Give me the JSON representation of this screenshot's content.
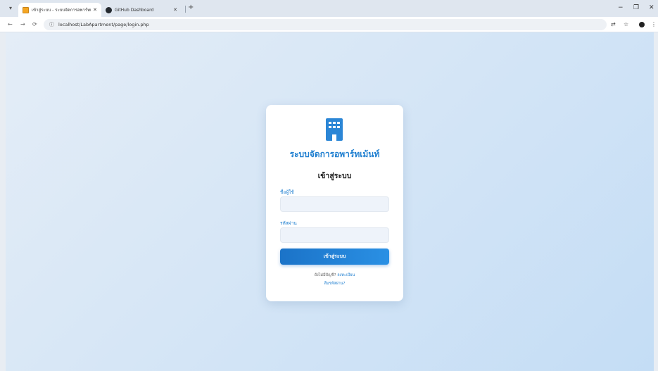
{
  "browser": {
    "tab_menu_glyph": "▾",
    "tabs": [
      {
        "title": "เข้าสู่ระบบ - ระบบจัดการอพาร์ทเม้นท์",
        "close": "✕",
        "favicon": "apartment-favicon"
      },
      {
        "title": "GitHub Dashboard",
        "close": "✕",
        "favicon": "github-favicon"
      }
    ],
    "new_tab": "+",
    "window_controls": {
      "minimize": "−",
      "restore": "❐",
      "close": "✕"
    },
    "nav": {
      "back": "←",
      "forward": "→",
      "reload": "⟳"
    },
    "address": {
      "info_glyph": "ⓘ",
      "url": "localhost/LabApartment/page/login.php"
    },
    "toolbar_icons": {
      "translate": "⇄",
      "bookmark": "☆",
      "menu": "⋮"
    }
  },
  "login": {
    "app_title": "ระบบจัดการอพาร์ทเม้นท์",
    "heading": "เข้าสู่ระบบ",
    "username_label": "ชื่อผู้ใช้",
    "username_value": "",
    "password_label": "รหัสผ่าน",
    "password_value": "",
    "submit_label": "เข้าสู่ระบบ",
    "no_account_text": "ยังไม่มีบัญชี?",
    "register_link": "ลงทะเบียน",
    "forgot_link": "ลืมรหัสผ่าน?",
    "logo_icon": "building-icon"
  },
  "colors": {
    "accent": "#1f7fd0",
    "button_start": "#1b73c8",
    "button_end": "#2a90e4",
    "page_bg_light": "#e4edf7",
    "page_bg_dark": "#c4ddf5"
  }
}
